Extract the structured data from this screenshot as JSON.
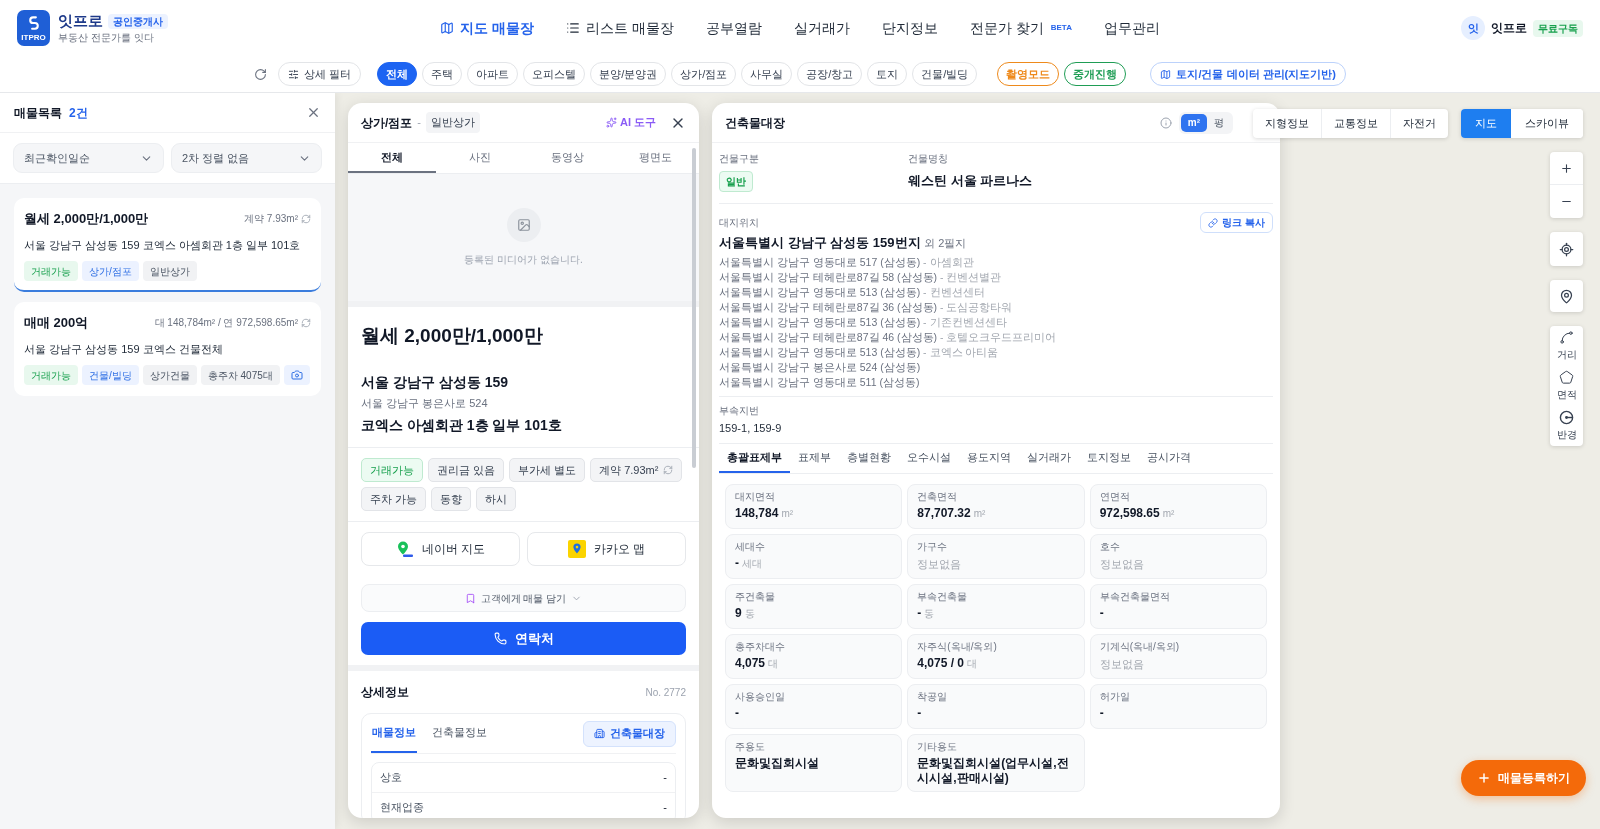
{
  "header": {
    "logo_text": "ITPRO",
    "brand": "잇프로",
    "brand_badge": "공인중개사",
    "tagline": "부동산 전문가를 잇다",
    "nav": [
      {
        "label": "지도 매물장",
        "selected": true
      },
      {
        "label": "리스트 매물장",
        "selected": false
      },
      {
        "label": "공부열람",
        "selected": false
      },
      {
        "label": "실거래가",
        "selected": false
      },
      {
        "label": "단지정보",
        "selected": false
      },
      {
        "label": "전문가 찾기",
        "badge": "BETA",
        "selected": false
      },
      {
        "label": "업무관리",
        "selected": false
      }
    ],
    "user": {
      "avatar": "잇",
      "name": "잇프로",
      "plan": "무료구독"
    }
  },
  "filter_bar": {
    "detail_filter": "상세 필터",
    "categories": [
      {
        "label": "전체",
        "selected": true
      },
      {
        "label": "주택",
        "selected": false
      },
      {
        "label": "아파트",
        "selected": false
      },
      {
        "label": "오피스텔",
        "selected": false
      },
      {
        "label": "분양/분양권",
        "selected": false
      },
      {
        "label": "상가/점포",
        "selected": false
      },
      {
        "label": "사무실",
        "selected": false
      },
      {
        "label": "공장/창고",
        "selected": false
      },
      {
        "label": "토지",
        "selected": false
      },
      {
        "label": "건물/빌딩",
        "selected": false
      }
    ],
    "modes": [
      {
        "label": "촬영모드",
        "color": "#ee8a1c"
      },
      {
        "label": "중개진행",
        "color": "#1f9d55"
      }
    ],
    "data_button": "토지/건물 데이터 관리(지도기반)"
  },
  "left_panel": {
    "title": "매물목록",
    "count": "2건",
    "sorts": [
      {
        "value": "최근확인일순"
      },
      {
        "value": "2차 정렬 없음"
      }
    ],
    "listings": [
      {
        "price": "월세 2,000만/1,000만",
        "area": "계약 7.93m²",
        "address": "서울 강남구 삼성동 159 코엑스 아셈회관 1층 일부 101호",
        "selected": true,
        "tags": [
          {
            "label": "거래가능",
            "kind": "status"
          },
          {
            "label": "상가/점포",
            "kind": "category"
          },
          {
            "label": "일반상가",
            "kind": "plain"
          }
        ]
      },
      {
        "price": "매매 200억",
        "area": "대 148,784m² / 연 972,598.65m²",
        "address": "서울 강남구 삼성동 159 코엑스 건물전체",
        "selected": false,
        "tags": [
          {
            "label": "거래가능",
            "kind": "status"
          },
          {
            "label": "건물/빌딩",
            "kind": "category"
          },
          {
            "label": "상가건물",
            "kind": "plain"
          },
          {
            "label": "총주차 4075대",
            "kind": "plain"
          },
          {
            "kind": "photo"
          }
        ]
      }
    ]
  },
  "detail_panel": {
    "category": "상가/점포",
    "separator": "-",
    "subcategory": "일반상가",
    "ai_button": "AI 도구",
    "tabs": [
      {
        "label": "전체",
        "selected": true
      },
      {
        "label": "사진",
        "selected": false
      },
      {
        "label": "동영상",
        "selected": false
      },
      {
        "label": "평면도",
        "selected": false
      }
    ],
    "media_empty": "등록된 미디어가 없습니다.",
    "price": "월세 2,000만/1,000만",
    "address": "서울 강남구 삼성동 159",
    "road_address": "서울 강남구 봉은사로 524",
    "unit": "코엑스 아셈회관 1층 일부 101호",
    "tags": [
      {
        "label": "거래가능",
        "kind": "status"
      },
      {
        "label": "권리금 있음",
        "kind": "plain"
      },
      {
        "label": "부가세 별도",
        "kind": "plain"
      },
      {
        "label": "계약 7.93m²",
        "kind": "area"
      },
      {
        "label": "주차 가능",
        "kind": "plain"
      },
      {
        "label": "동향",
        "kind": "plain"
      },
      {
        "label": "하시",
        "kind": "plain"
      }
    ],
    "map_links": [
      {
        "label": "네이버 지도"
      },
      {
        "label": "카카오 맵"
      }
    ],
    "save_button": "고객에게 매물 담기",
    "contact_button": "연락처",
    "details": {
      "title": "상세정보",
      "number": "No. 2772",
      "tabs": [
        {
          "label": "매물정보",
          "selected": true
        },
        {
          "label": "건축물정보",
          "selected": false
        }
      ],
      "register_button": "건축물대장",
      "rows": [
        {
          "label": "상호",
          "value": "-"
        },
        {
          "label": "현재업종",
          "value": "-"
        }
      ]
    }
  },
  "building_register": {
    "title": "건축물대장",
    "units": [
      {
        "label": "m²",
        "selected": true
      },
      {
        "label": "평",
        "selected": false
      }
    ],
    "type_label": "건물구분",
    "type": "일반",
    "name_label": "건물명칭",
    "name": "웨스틴 서울 파르나스",
    "site_label": "대지위치",
    "copy_link": "링크 복사",
    "lot": "서울특별시 강남구 삼성동 159번지",
    "lot_extra": "외 2필지",
    "road_addresses": [
      {
        "address": "서울특별시 강남구 영동대로 517 (삼성동)",
        "building": "- 아셈회관"
      },
      {
        "address": "서울특별시 강남구 테헤란로87길 58 (삼성동)",
        "building": "- 컨벤션별관"
      },
      {
        "address": "서울특별시 강남구 영동대로 513 (삼성동)",
        "building": "- 컨벤션센터"
      },
      {
        "address": "서울특별시 강남구 테헤란로87길 36 (삼성동)",
        "building": "- 도심공항타워"
      },
      {
        "address": "서울특별시 강남구 영동대로 513 (삼성동)",
        "building": "- 기존컨벤션센타"
      },
      {
        "address": "서울특별시 강남구 테헤란로87길 46 (삼성동)",
        "building": "- 호텔오크우드프리미어"
      },
      {
        "address": "서울특별시 강남구 영동대로 513 (삼성동)",
        "building": "- 코엑스 아티움"
      },
      {
        "address": "서울특별시 강남구 봉은사로 524 (삼성동)"
      },
      {
        "address": "서울특별시 강남구 영동대로 511 (삼성동)"
      }
    ],
    "sub_lots_label": "부속지번",
    "sub_lots": "159-1, 159-9",
    "tabs": [
      {
        "label": "총괄표제부",
        "selected": true
      },
      {
        "label": "표제부",
        "selected": false
      },
      {
        "label": "층별현황",
        "selected": false
      },
      {
        "label": "오수시설",
        "selected": false
      },
      {
        "label": "용도지역",
        "selected": false
      },
      {
        "label": "실거래가",
        "selected": false
      },
      {
        "label": "토지정보",
        "selected": false
      },
      {
        "label": "공시가격",
        "selected": false
      }
    ],
    "cards": [
      {
        "label": "대지면적",
        "value": "148,784",
        "unit": "m²",
        "kind": "value"
      },
      {
        "label": "건축면적",
        "value": "87,707.32",
        "unit": "m²",
        "kind": "value"
      },
      {
        "label": "연면적",
        "value": "972,598.65",
        "unit": "m²",
        "kind": "value"
      },
      {
        "label": "세대수",
        "value": "-",
        "unit": "세대",
        "kind": "value"
      },
      {
        "label": "가구수",
        "value": "정보없음",
        "kind": "missing"
      },
      {
        "label": "호수",
        "value": "정보없음",
        "kind": "missing"
      },
      {
        "label": "주건축물",
        "value": "9",
        "unit": "동",
        "kind": "value"
      },
      {
        "label": "부속건축물",
        "value": "-",
        "unit": "동",
        "kind": "value"
      },
      {
        "label": "부속건축물면적",
        "value": "-",
        "kind": "value"
      },
      {
        "label": "총주차대수",
        "value": "4,075",
        "unit": "대",
        "kind": "value"
      },
      {
        "label": "자주식(옥내/옥외)",
        "value": "4,075 / 0",
        "unit": "대",
        "kind": "value"
      },
      {
        "label": "기계식(옥내/옥외)",
        "value": "정보없음",
        "kind": "missing"
      },
      {
        "label": "사용승인일",
        "value": "-",
        "kind": "value"
      },
      {
        "label": "착공일",
        "value": "-",
        "kind": "value"
      },
      {
        "label": "허가일",
        "value": "-",
        "kind": "value"
      },
      {
        "label": "주용도",
        "value": "문화및집회시설",
        "kind": "value"
      },
      {
        "label": "기타용도",
        "value": "문화및집회시설(업무시설,전시시설,판매시설)",
        "kind": "value"
      }
    ]
  },
  "map": {
    "layers": [
      {
        "label": "지형정보"
      },
      {
        "label": "교통정보"
      },
      {
        "label": "자전거"
      }
    ],
    "views": [
      {
        "label": "지도",
        "selected": true
      },
      {
        "label": "스카이뷰",
        "selected": false
      }
    ],
    "tools": [
      {
        "label": "거리"
      },
      {
        "label": "면적"
      },
      {
        "label": "반경"
      }
    ],
    "register_button": "매물등록하기"
  }
}
